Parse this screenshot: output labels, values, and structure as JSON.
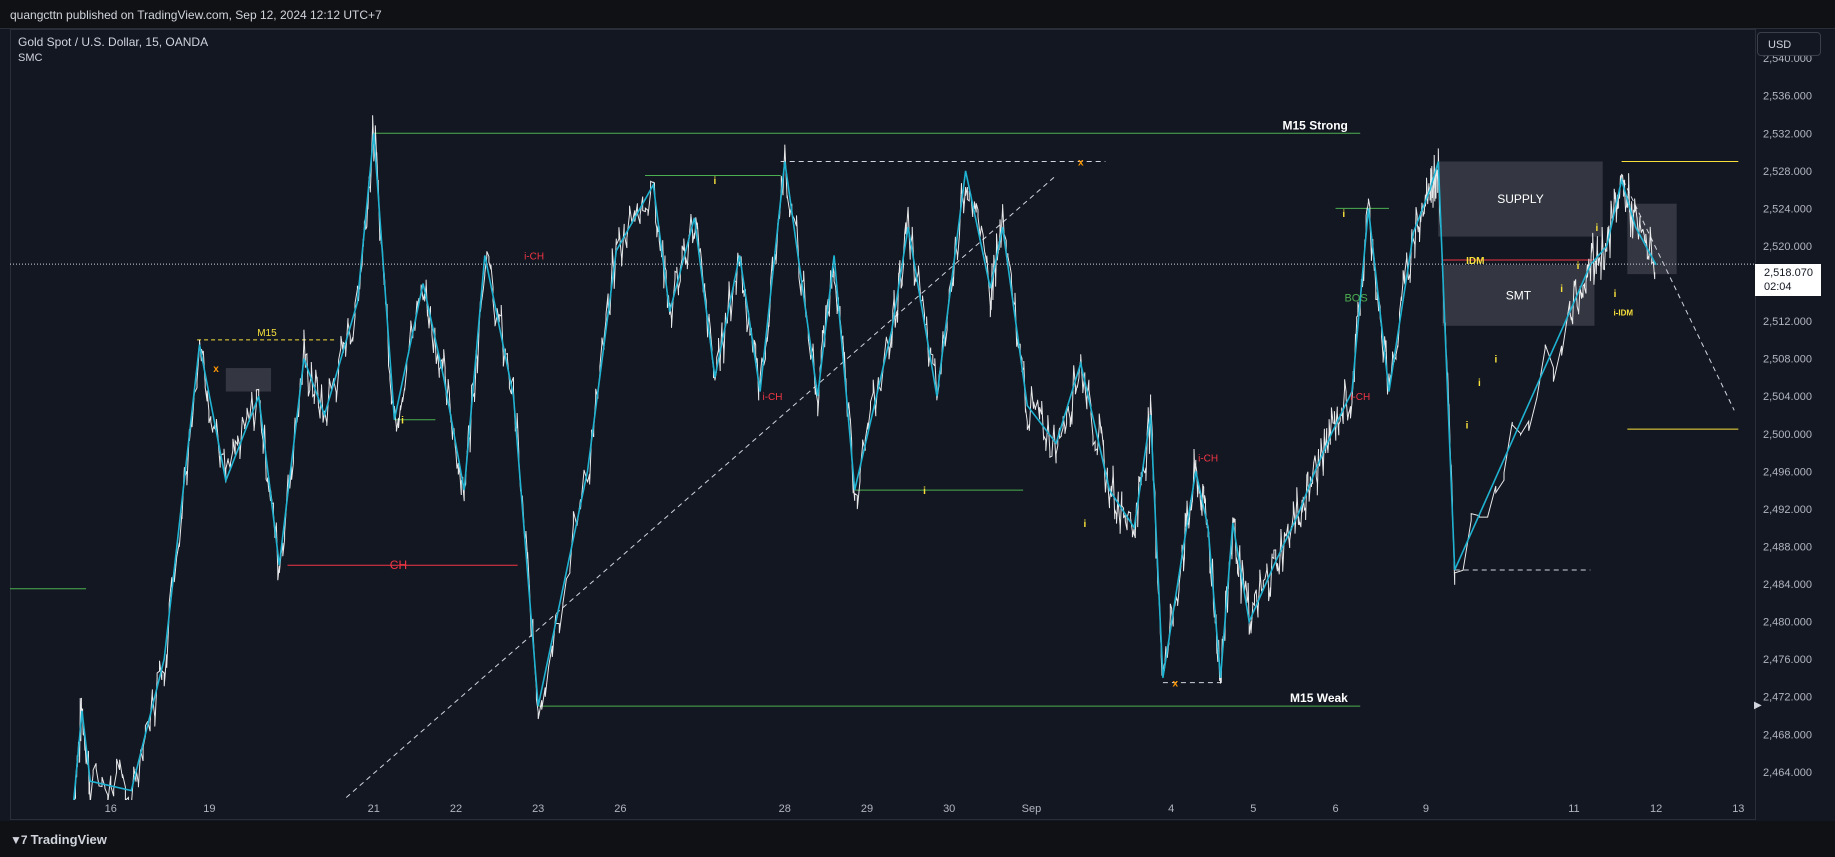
{
  "header": {
    "published": "quangcttn published on TradingView.com, Sep 12, 2024 12:12 UTC+7"
  },
  "legend": {
    "symbol": "Gold Spot / U.S. Dollar, 15, OANDA",
    "indicator": "SMC"
  },
  "price_axis": {
    "currency": "USD"
  },
  "current_price": {
    "value": "2,518.070",
    "countdown": "02:04"
  },
  "footer": {
    "brand": "TradingView",
    "brand_icon": "tradingview-logo-icon"
  },
  "colors": {
    "background": "#131722",
    "zigzag": "#1fb2d1",
    "price": "#ffffff",
    "structure_green": "#4caf50",
    "choch_red": "#f23645",
    "idm_yellow": "#f7e03b",
    "zone_gray": "#787b86"
  },
  "chart_data": {
    "type": "line",
    "instrument": "Gold Spot / U.S. Dollar",
    "timeframe": "15",
    "ylim": [
      2461,
      2543
    ],
    "y_ticks": [
      "2,464.000",
      "2,468.000",
      "2,472.000",
      "2,476.000",
      "2,480.000",
      "2,484.000",
      "2,488.000",
      "2,492.000",
      "2,496.000",
      "2,500.000",
      "2,504.000",
      "2,508.000",
      "2,512.000",
      "2,516.000",
      "2,520.000",
      "2,524.000",
      "2,528.000",
      "2,532.000",
      "2,536.000",
      "2,540.000"
    ],
    "x_ticks": [
      {
        "label": "16",
        "x": 0.8
      },
      {
        "label": "19",
        "x": 2.0
      },
      {
        "label": "21",
        "x": 4.0
      },
      {
        "label": "22",
        "x": 5.0
      },
      {
        "label": "23",
        "x": 6.0
      },
      {
        "label": "26",
        "x": 7.0
      },
      {
        "label": "28",
        "x": 9.0
      },
      {
        "label": "29",
        "x": 10.0
      },
      {
        "label": "30",
        "x": 11.0
      },
      {
        "label": "Sep",
        "x": 12.0
      },
      {
        "label": "4",
        "x": 13.7
      },
      {
        "label": "5",
        "x": 14.7
      },
      {
        "label": "6",
        "x": 15.7
      },
      {
        "label": "9",
        "x": 16.8
      },
      {
        "label": "11",
        "x": 18.6
      },
      {
        "label": "12",
        "x": 19.6
      },
      {
        "label": "13",
        "x": 20.6
      }
    ],
    "zigzag": [
      [
        0.35,
        2461
      ],
      [
        0.45,
        2470.5
      ],
      [
        0.55,
        2463
      ],
      [
        1.05,
        2462
      ],
      [
        1.45,
        2476
      ],
      [
        1.88,
        2509.5
      ],
      [
        2.2,
        2495
      ],
      [
        2.6,
        2504
      ],
      [
        2.85,
        2486
      ],
      [
        3.15,
        2508
      ],
      [
        3.4,
        2502
      ],
      [
        3.8,
        2514
      ],
      [
        4.0,
        2532
      ],
      [
        4.25,
        2501.5
      ],
      [
        4.6,
        2516
      ],
      [
        4.85,
        2506
      ],
      [
        5.1,
        2494
      ],
      [
        5.35,
        2519
      ],
      [
        5.7,
        2504
      ],
      [
        6.0,
        2471
      ],
      [
        6.6,
        2496
      ],
      [
        6.95,
        2519.5
      ],
      [
        7.4,
        2526.5
      ],
      [
        7.6,
        2513
      ],
      [
        7.9,
        2523
      ],
      [
        8.15,
        2506
      ],
      [
        8.45,
        2519
      ],
      [
        8.7,
        2504.5
      ],
      [
        9.0,
        2529
      ],
      [
        9.4,
        2504
      ],
      [
        9.6,
        2519
      ],
      [
        9.85,
        2494
      ],
      [
        10.3,
        2511
      ],
      [
        10.5,
        2522
      ],
      [
        10.85,
        2504
      ],
      [
        11.2,
        2528
      ],
      [
        11.5,
        2515.5
      ],
      [
        11.65,
        2522
      ],
      [
        11.95,
        2503
      ],
      [
        12.3,
        2499
      ],
      [
        12.6,
        2507.5
      ],
      [
        12.95,
        2494
      ],
      [
        13.25,
        2490
      ],
      [
        13.45,
        2502
      ],
      [
        13.6,
        2474
      ],
      [
        13.85,
        2488
      ],
      [
        14.0,
        2496
      ],
      [
        14.15,
        2490
      ],
      [
        14.3,
        2474
      ],
      [
        14.45,
        2490.5
      ],
      [
        14.65,
        2480
      ],
      [
        14.95,
        2486
      ],
      [
        15.25,
        2491.5
      ],
      [
        15.45,
        2496
      ],
      [
        15.65,
        2500
      ],
      [
        15.9,
        2504.5
      ],
      [
        16.1,
        2524
      ],
      [
        16.35,
        2504.5
      ],
      [
        16.65,
        2521.5
      ],
      [
        16.85,
        2526
      ],
      [
        16.95,
        2529
      ],
      [
        17.15,
        2485.5
      ],
      [
        18.55,
        2513
      ],
      [
        18.8,
        2518
      ],
      [
        19.0,
        2520
      ],
      [
        19.18,
        2527
      ],
      [
        19.35,
        2522
      ],
      [
        19.6,
        2518
      ]
    ],
    "overlay_levels": [
      {
        "label": "M15 Strong",
        "y": 2532
      },
      {
        "label": "M15 Weak",
        "y": 2471
      },
      {
        "label": "CH",
        "y": 2486
      },
      {
        "label": "M15",
        "y": 2510
      }
    ],
    "annotations": [
      {
        "label": "i-CH",
        "x": 5.95,
        "y": 2519
      },
      {
        "label": "i-CH",
        "x": 8.85,
        "y": 2504
      },
      {
        "label": "i-CH",
        "x": 14.15,
        "y": 2497.5
      },
      {
        "label": "i-CH",
        "x": 16.0,
        "y": 2504
      },
      {
        "label": "i",
        "x": 4.35,
        "y": 2501.5
      },
      {
        "label": "i",
        "x": 8.15,
        "y": 2527
      },
      {
        "label": "i",
        "x": 10.7,
        "y": 2494
      },
      {
        "label": "i",
        "x": 12.65,
        "y": 2490.5
      },
      {
        "label": "i",
        "x": 15.8,
        "y": 2523.5
      },
      {
        "label": "i",
        "x": 17.3,
        "y": 2501
      },
      {
        "label": "i",
        "x": 17.45,
        "y": 2505.5
      },
      {
        "label": "i",
        "x": 17.65,
        "y": 2508
      },
      {
        "label": "i",
        "x": 18.45,
        "y": 2515.5
      },
      {
        "label": "i",
        "x": 18.65,
        "y": 2518
      },
      {
        "label": "i",
        "x": 18.88,
        "y": 2522
      },
      {
        "label": "i",
        "x": 19.1,
        "y": 2515
      },
      {
        "label": "x",
        "x": 2.08,
        "y": 2507
      },
      {
        "label": "x",
        "x": 12.6,
        "y": 2529
      },
      {
        "label": "x",
        "x": 13.75,
        "y": 2473.5
      },
      {
        "label": "BOS",
        "x": 15.95,
        "y": 2514.5
      },
      {
        "label": "IDM",
        "x": 17.4,
        "y": 2518.5
      },
      {
        "label": "i-IDM",
        "x": 19.2,
        "y": 2513
      }
    ],
    "zones": [
      {
        "label": "SUPPLY",
        "x0": 16.95,
        "x1": 18.95,
        "y0": 2521,
        "y1": 2529
      },
      {
        "label": "SMT",
        "x0": 17.0,
        "x1": 18.85,
        "y0": 2511.5,
        "y1": 2518
      },
      {
        "label": "",
        "x0": 19.25,
        "x1": 19.85,
        "y0": 2517,
        "y1": 2524.5
      },
      {
        "label": "",
        "x0": 2.2,
        "x1": 2.75,
        "y0": 2504.5,
        "y1": 2507
      }
    ]
  }
}
